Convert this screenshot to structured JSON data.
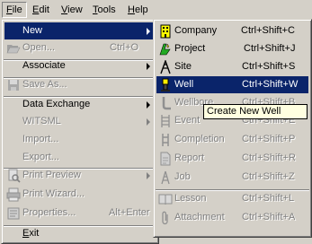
{
  "menubar": {
    "items": [
      {
        "label": "File",
        "mnemonic": "F",
        "rest": "ile"
      },
      {
        "label": "Edit",
        "mnemonic": "E",
        "rest": "dit"
      },
      {
        "label": "View",
        "mnemonic": "V",
        "rest": "iew"
      },
      {
        "label": "Tools",
        "mnemonic": "T",
        "rest": "ools"
      },
      {
        "label": "Help",
        "mnemonic": "H",
        "rest": "elp"
      }
    ]
  },
  "file_menu": {
    "new": "New",
    "open": "Open...",
    "open_shortcut": "Ctrl+O",
    "associate": "Associate",
    "save_as": "Save As...",
    "data_exchange": "Data Exchange",
    "witsml": "WITSML",
    "import": "Import...",
    "export": "Export...",
    "print_preview": "Print Preview",
    "print_wizard": "Print Wizard...",
    "properties": "Properties...",
    "properties_shortcut": "Alt+Enter",
    "exit": "Exit"
  },
  "new_submenu": {
    "items": [
      {
        "label": "Company",
        "shortcut": "Ctrl+Shift+C",
        "icon": "company-icon",
        "enabled": true
      },
      {
        "label": "Project",
        "shortcut": "Ctrl+Shift+J",
        "icon": "project-icon",
        "enabled": true
      },
      {
        "label": "Site",
        "shortcut": "Ctrl+Shift+S",
        "icon": "site-icon",
        "enabled": true
      },
      {
        "label": "Well",
        "shortcut": "Ctrl+Shift+W",
        "icon": "well-icon",
        "enabled": true,
        "selected": true
      },
      {
        "label": "Wellbore",
        "shortcut": "Ctrl+Shift+B",
        "icon": "wellbore-icon",
        "enabled": false
      },
      {
        "label": "Event",
        "shortcut": "Ctrl+Shift+E",
        "icon": "event-icon",
        "enabled": false
      },
      {
        "label": "Completion",
        "shortcut": "Ctrl+Shift+P",
        "icon": "completion-icon",
        "enabled": false
      },
      {
        "label": "Report",
        "shortcut": "Ctrl+Shift+R",
        "icon": "report-icon",
        "enabled": false
      },
      {
        "label": "Job",
        "shortcut": "Ctrl+Shift+Z",
        "icon": "job-icon",
        "enabled": false
      },
      {
        "label": "Lesson",
        "shortcut": "Ctrl+Shift+L",
        "icon": "lesson-icon",
        "enabled": false
      },
      {
        "label": "Attachment",
        "shortcut": "Ctrl+Shift+A",
        "icon": "attachment-icon",
        "enabled": false
      }
    ]
  },
  "tooltip": {
    "text": "Create New Well"
  },
  "colors": {
    "menu_bg": "#d4d0c8",
    "selection": "#0a246a",
    "tooltip_bg": "#ffffe1",
    "disabled_text": "#808080"
  }
}
